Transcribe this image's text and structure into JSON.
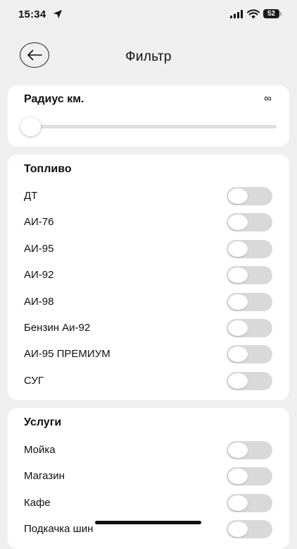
{
  "status_bar": {
    "time": "15:34",
    "battery": "52"
  },
  "header": {
    "title": "Фильтр"
  },
  "radius": {
    "title": "Радиус км.",
    "value": "∞",
    "slider_value": 0
  },
  "fuel": {
    "title": "Топливо",
    "items": [
      {
        "label": "ДТ",
        "on": false
      },
      {
        "label": "АИ-76",
        "on": false
      },
      {
        "label": "АИ-95",
        "on": false
      },
      {
        "label": "АИ-92",
        "on": false
      },
      {
        "label": "АИ-98",
        "on": false
      },
      {
        "label": "Бензин Аи-92",
        "on": false
      },
      {
        "label": "АИ-95 ПРЕМИУМ",
        "on": false
      },
      {
        "label": "СУГ",
        "on": false
      }
    ]
  },
  "services": {
    "title": "Услуги",
    "items": [
      {
        "label": "Мойка",
        "on": false
      },
      {
        "label": "Магазин",
        "on": false
      },
      {
        "label": "Кафе",
        "on": false
      },
      {
        "label": "Подкачка шин",
        "on": false
      }
    ]
  },
  "colors": {
    "background": "#efefef",
    "card": "#ffffff",
    "toggle_off": "#d9d9d9",
    "text": "#111111"
  }
}
